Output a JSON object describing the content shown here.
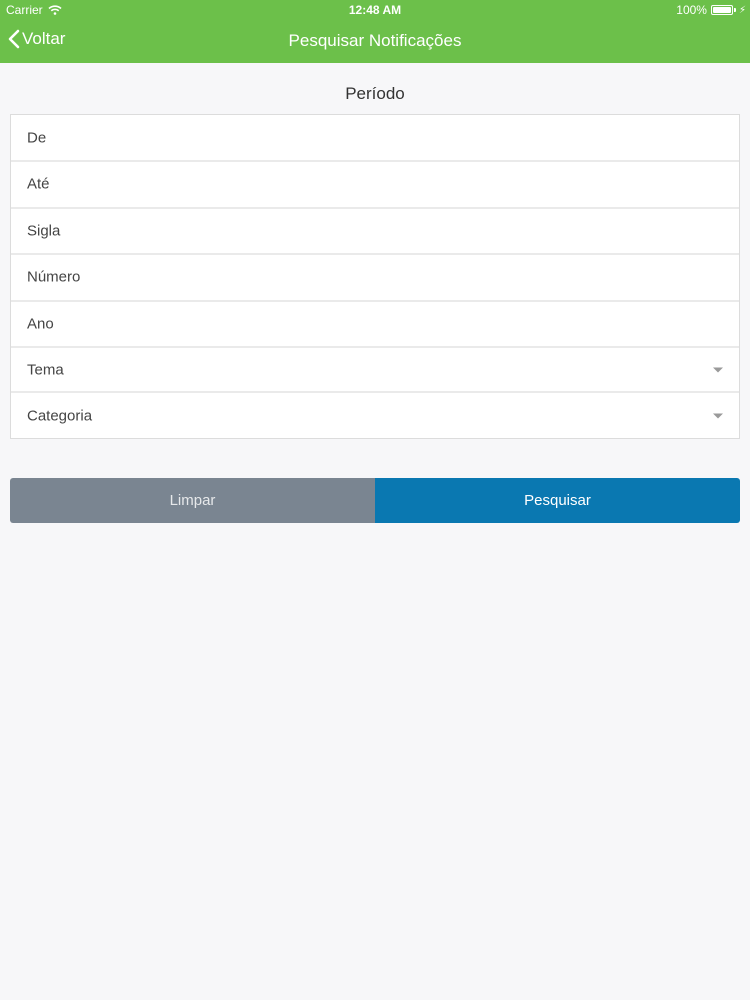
{
  "status_bar": {
    "carrier": "Carrier",
    "time": "12:48 AM",
    "battery": "100%"
  },
  "nav": {
    "back_label": "Voltar",
    "title": "Pesquisar Notificações"
  },
  "section_title": "Período",
  "fields": [
    {
      "label": "De",
      "type": "input"
    },
    {
      "label": "Até",
      "type": "input"
    },
    {
      "label": "Sigla",
      "type": "input"
    },
    {
      "label": "Número",
      "type": "input"
    },
    {
      "label": "Ano",
      "type": "input"
    },
    {
      "label": "Tema",
      "type": "select"
    },
    {
      "label": "Categoria",
      "type": "select"
    }
  ],
  "buttons": {
    "clear_label": "Limpar",
    "search_label": "Pesquisar"
  },
  "colors": {
    "header": "#6cc04a",
    "clear_button": "#7a8591",
    "search_button": "#0a78b1"
  }
}
